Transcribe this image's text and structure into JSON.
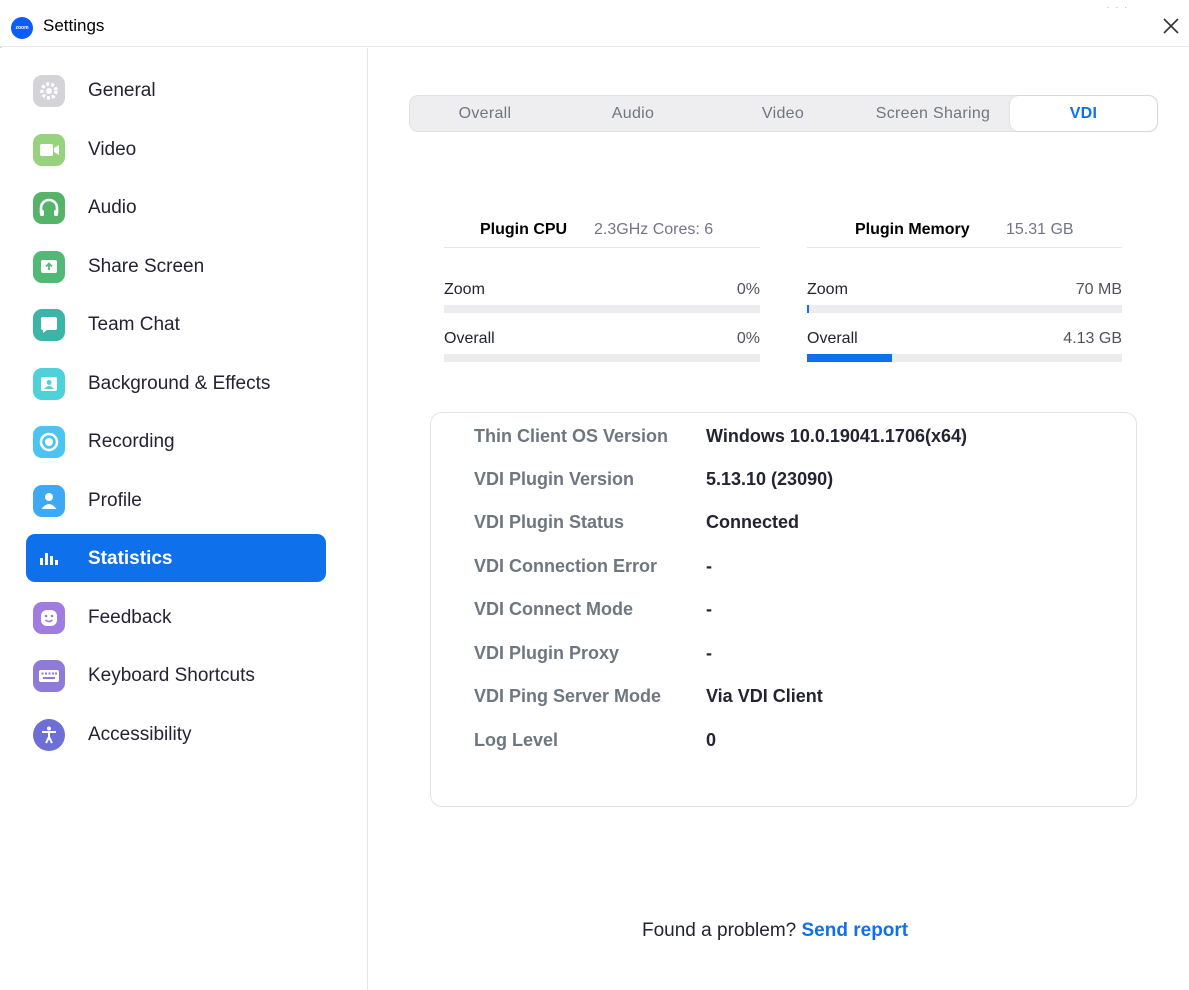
{
  "window": {
    "title": "Settings",
    "logo_text": "zoom",
    "corner_mark": "· · ·"
  },
  "sidebar": {
    "items": [
      {
        "label": "General",
        "icon": "gear-icon",
        "color": "#d4d4d8"
      },
      {
        "label": "Video",
        "icon": "video-camera-icon",
        "color": "#97d37e"
      },
      {
        "label": "Audio",
        "icon": "headphones-icon",
        "color": "#56b36a"
      },
      {
        "label": "Share Screen",
        "icon": "share-screen-icon",
        "color": "#52b876"
      },
      {
        "label": "Team Chat",
        "icon": "chat-bubble-icon",
        "color": "#3cb4a8"
      },
      {
        "label": "Background & Effects",
        "icon": "background-icon",
        "color": "#4fd1da"
      },
      {
        "label": "Recording",
        "icon": "record-icon",
        "color": "#4cc4f2"
      },
      {
        "label": "Profile",
        "icon": "profile-icon",
        "color": "#3fa8f3"
      },
      {
        "label": "Statistics",
        "icon": "statistics-icon",
        "color": "#0e71eb",
        "active": true
      },
      {
        "label": "Feedback",
        "icon": "feedback-smile-icon",
        "color": "#a07be0"
      },
      {
        "label": "Keyboard Shortcuts",
        "icon": "keyboard-icon",
        "color": "#8e7ad7"
      },
      {
        "label": "Accessibility",
        "icon": "accessibility-icon",
        "color": "#6e6fd6"
      }
    ]
  },
  "tabs": [
    {
      "label": "Overall"
    },
    {
      "label": "Audio"
    },
    {
      "label": "Video"
    },
    {
      "label": "Screen Sharing"
    },
    {
      "label": "VDI",
      "active": true
    }
  ],
  "cpu": {
    "label": "Plugin CPU",
    "value": "2.3GHz  Cores: 6",
    "rows": [
      {
        "name": "Zoom",
        "value": "0%",
        "fill": 0
      },
      {
        "name": "Overall",
        "value": "0%",
        "fill": 0
      }
    ]
  },
  "memory": {
    "label": "Plugin Memory",
    "value": "15.31 GB",
    "rows": [
      {
        "name": "Zoom",
        "value": "70 MB",
        "fill": 0.005
      },
      {
        "name": "Overall",
        "value": "4.13 GB",
        "fill": 0.27
      }
    ]
  },
  "vdi_info": [
    {
      "key": "Thin Client OS Version",
      "value": "Windows 10.0.19041.1706(x64)"
    },
    {
      "key": "VDI Plugin Version",
      "value": "5.13.10 (23090)"
    },
    {
      "key": "VDI Plugin Status",
      "value": "Connected"
    },
    {
      "key": "VDI Connection Error",
      "value": "-"
    },
    {
      "key": "VDI Connect Mode",
      "value": "-"
    },
    {
      "key": "VDI Plugin Proxy",
      "value": "-"
    },
    {
      "key": "VDI Ping Server Mode",
      "value": "Via VDI Client"
    },
    {
      "key": "Log Level",
      "value": "0"
    }
  ],
  "footer": {
    "text": "Found a problem?",
    "link": "Send report"
  },
  "colors": {
    "accent": "#0e71eb",
    "text": "#232333",
    "muted": "#6e7680"
  }
}
